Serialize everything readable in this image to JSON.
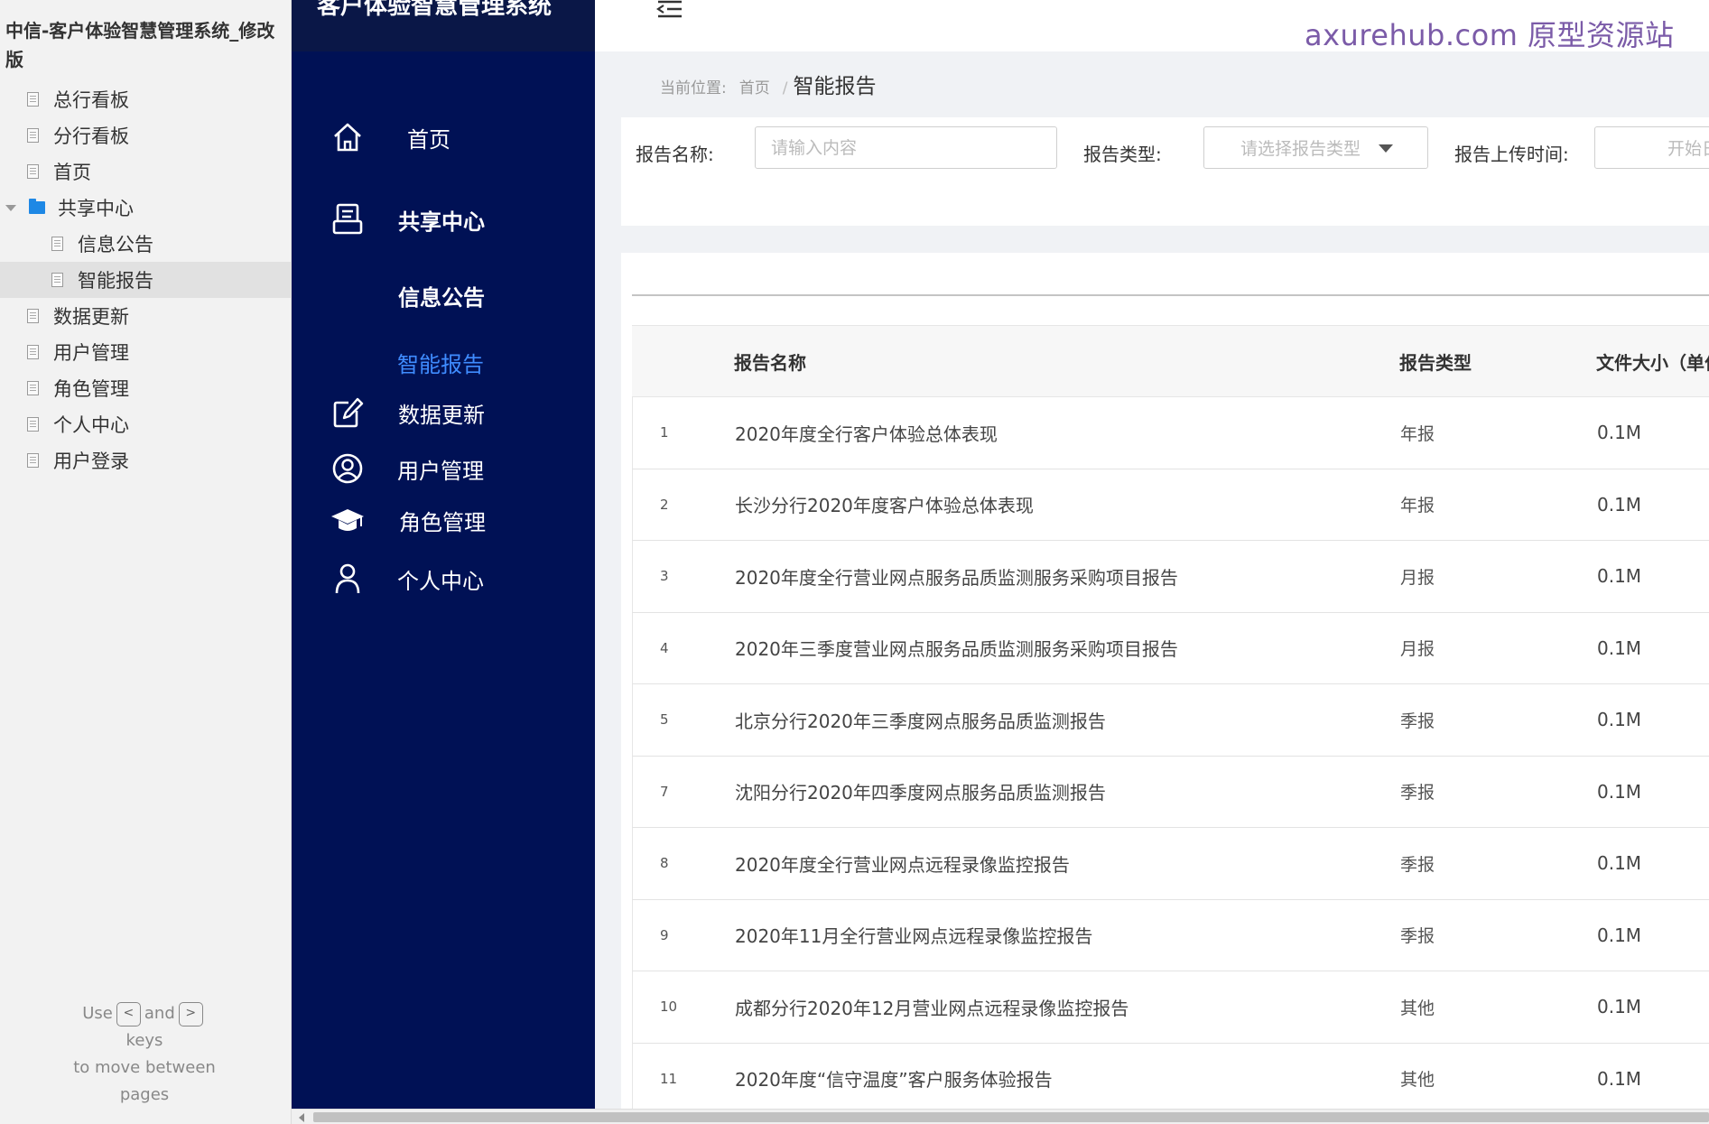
{
  "tree": {
    "project_title": "中信-客户体验智慧管理系统_修改版",
    "items": [
      {
        "label": "总行看板",
        "kind": "page",
        "level": 1
      },
      {
        "label": "分行看板",
        "kind": "page",
        "level": 1
      },
      {
        "label": "首页",
        "kind": "page",
        "level": 1
      },
      {
        "label": "共享中心",
        "kind": "folder",
        "level": 1
      },
      {
        "label": "信息公告",
        "kind": "page",
        "level": 2
      },
      {
        "label": "智能报告",
        "kind": "page",
        "level": 2,
        "selected": true
      },
      {
        "label": "数据更新",
        "kind": "page",
        "level": 1
      },
      {
        "label": "用户管理",
        "kind": "page",
        "level": 1
      },
      {
        "label": "角色管理",
        "kind": "page",
        "level": 1
      },
      {
        "label": "个人中心",
        "kind": "page",
        "level": 1
      },
      {
        "label": "用户登录",
        "kind": "page",
        "level": 1
      }
    ],
    "hint": {
      "use": "Use",
      "and": "and",
      "keys": "keys",
      "line3": "to move between",
      "line4": "pages",
      "key_prev": "<",
      "key_next": ">"
    }
  },
  "app": {
    "title": "客户体验智慧管理系统",
    "nav": [
      {
        "label": "首页",
        "icon": "home-icon"
      },
      {
        "label": "共享中心",
        "icon": "share-center-icon"
      },
      {
        "label": "信息公告",
        "icon": ""
      },
      {
        "label": "智能报告",
        "icon": "",
        "active": true
      },
      {
        "label": "数据更新",
        "icon": "edit-icon"
      },
      {
        "label": "用户管理",
        "icon": "user-circle-icon"
      },
      {
        "label": "角色管理",
        "icon": "graduation-cap-icon"
      },
      {
        "label": "个人中心",
        "icon": "person-icon"
      }
    ],
    "watermark": "axurehub.com 原型资源站",
    "active_color": "#3f8cff",
    "nav_bg": "#001155"
  },
  "breadcrumb": {
    "prefix": "当前位置:",
    "home": "首页",
    "sep": "/",
    "current": "智能报告"
  },
  "filters": {
    "name_label": "报告名称:",
    "name_placeholder": "请输入内容",
    "type_label": "报告类型:",
    "type_placeholder": "请选择报告类型",
    "time_label": "报告上传时间:",
    "time_placeholder": "开始日期"
  },
  "table": {
    "headers": {
      "name": "报告名称",
      "type": "报告类型",
      "size": "文件大小（单位）"
    },
    "rows": [
      {
        "idx": "1",
        "name": "2020年度全行客户体验总体表现",
        "type": "年报",
        "size": "0.1M"
      },
      {
        "idx": "2",
        "name": "长沙分行2020年度客户体验总体表现",
        "type": "年报",
        "size": "0.1M"
      },
      {
        "idx": "3",
        "name": "2020年度全行营业网点服务品质监测服务采购项目报告",
        "type": "月报",
        "size": "0.1M"
      },
      {
        "idx": "4",
        "name": "2020年三季度营业网点服务品质监测服务采购项目报告",
        "type": "月报",
        "size": "0.1M"
      },
      {
        "idx": "5",
        "name": "北京分行2020年三季度网点服务品质监测报告",
        "type": "季报",
        "size": "0.1M"
      },
      {
        "idx": "7",
        "name": "沈阳分行2020年四季度网点服务品质监测报告",
        "type": "季报",
        "size": "0.1M"
      },
      {
        "idx": "8",
        "name": "2020年度全行营业网点远程录像监控报告",
        "type": "季报",
        "size": "0.1M"
      },
      {
        "idx": "9",
        "name": "2020年11月全行营业网点远程录像监控报告",
        "type": "季报",
        "size": "0.1M"
      },
      {
        "idx": "10",
        "name": "成都分行2020年12月营业网点远程录像监控报告",
        "type": "其他",
        "size": "0.1M"
      },
      {
        "idx": "11",
        "name": "2020年度“信守温度”客户服务体验报告",
        "type": "其他",
        "size": "0.1M"
      }
    ]
  }
}
